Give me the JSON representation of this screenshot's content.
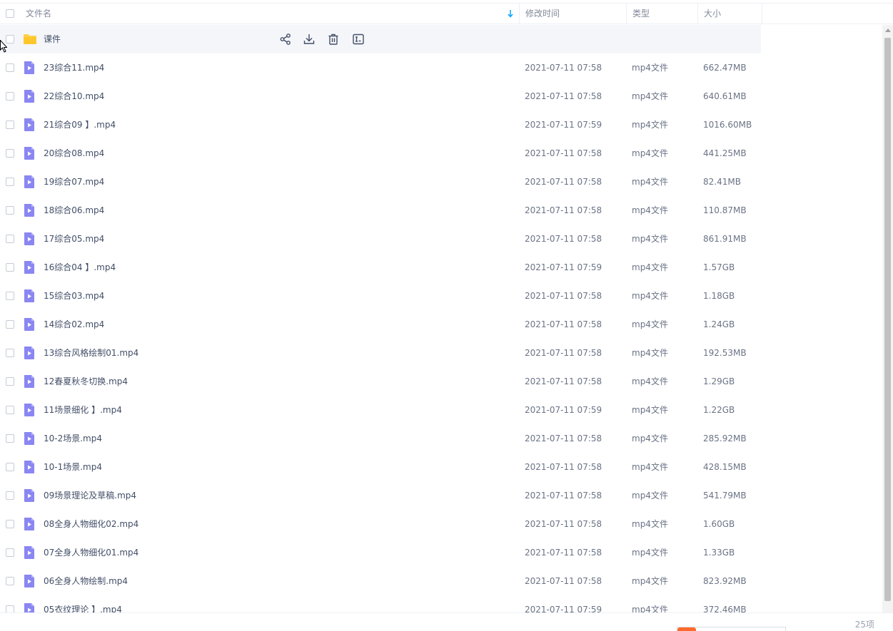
{
  "header": {
    "name_label": "文件名",
    "mtime_label": "修改时间",
    "type_label": "类型",
    "size_label": "大小",
    "sort_icon": "sort-arrow-down-icon"
  },
  "colors": {
    "accent": "#06a7ff",
    "folder": "#ffd04b",
    "video": "#8a86f2"
  },
  "folder_row": {
    "name": "课件",
    "actions": [
      {
        "icon": "share-icon"
      },
      {
        "icon": "download-icon"
      },
      {
        "icon": "delete-icon"
      },
      {
        "icon": "rename-icon"
      }
    ]
  },
  "files": [
    {
      "name": "23综合11.mp4",
      "mtime": "2021-07-11 07:58",
      "type": "mp4文件",
      "size": "662.47MB"
    },
    {
      "name": "22综合10.mp4",
      "mtime": "2021-07-11 07:58",
      "type": "mp4文件",
      "size": "640.61MB"
    },
    {
      "name": "21综合09 】.mp4",
      "mtime": "2021-07-11 07:59",
      "type": "mp4文件",
      "size": "1016.60MB"
    },
    {
      "name": "20综合08.mp4",
      "mtime": "2021-07-11 07:58",
      "type": "mp4文件",
      "size": "441.25MB"
    },
    {
      "name": "19综合07.mp4",
      "mtime": "2021-07-11 07:58",
      "type": "mp4文件",
      "size": "82.41MB"
    },
    {
      "name": "18综合06.mp4",
      "mtime": "2021-07-11 07:58",
      "type": "mp4文件",
      "size": "110.87MB"
    },
    {
      "name": "17综合05.mp4",
      "mtime": "2021-07-11 07:58",
      "type": "mp4文件",
      "size": "861.91MB"
    },
    {
      "name": "16综合04 】.mp4",
      "mtime": "2021-07-11 07:59",
      "type": "mp4文件",
      "size": "1.57GB"
    },
    {
      "name": "15综合03.mp4",
      "mtime": "2021-07-11 07:58",
      "type": "mp4文件",
      "size": "1.18GB"
    },
    {
      "name": "14综合02.mp4",
      "mtime": "2021-07-11 07:58",
      "type": "mp4文件",
      "size": "1.24GB"
    },
    {
      "name": "13综合风格绘制01.mp4",
      "mtime": "2021-07-11 07:58",
      "type": "mp4文件",
      "size": "192.53MB"
    },
    {
      "name": "12春夏秋冬切换.mp4",
      "mtime": "2021-07-11 07:58",
      "type": "mp4文件",
      "size": "1.29GB"
    },
    {
      "name": "11场景细化 】.mp4",
      "mtime": "2021-07-11 07:59",
      "type": "mp4文件",
      "size": "1.22GB"
    },
    {
      "name": "10-2场景.mp4",
      "mtime": "2021-07-11 07:58",
      "type": "mp4文件",
      "size": "285.92MB"
    },
    {
      "name": "10-1场景.mp4",
      "mtime": "2021-07-11 07:58",
      "type": "mp4文件",
      "size": "428.15MB"
    },
    {
      "name": "09场景理论及草稿.mp4",
      "mtime": "2021-07-11 07:58",
      "type": "mp4文件",
      "size": "541.79MB"
    },
    {
      "name": "08全身人物细化02.mp4",
      "mtime": "2021-07-11 07:58",
      "type": "mp4文件",
      "size": "1.60GB"
    },
    {
      "name": "07全身人物细化01.mp4",
      "mtime": "2021-07-11 07:58",
      "type": "mp4文件",
      "size": "1.33GB"
    },
    {
      "name": "06全身人物绘制.mp4",
      "mtime": "2021-07-11 07:58",
      "type": "mp4文件",
      "size": "823.92MB"
    },
    {
      "name": "05衣纹理论 】.mp4",
      "mtime": "2021-07-11 07:59",
      "type": "mp4文件",
      "size": "372.46MB"
    }
  ],
  "footer": {
    "count": "25项"
  }
}
